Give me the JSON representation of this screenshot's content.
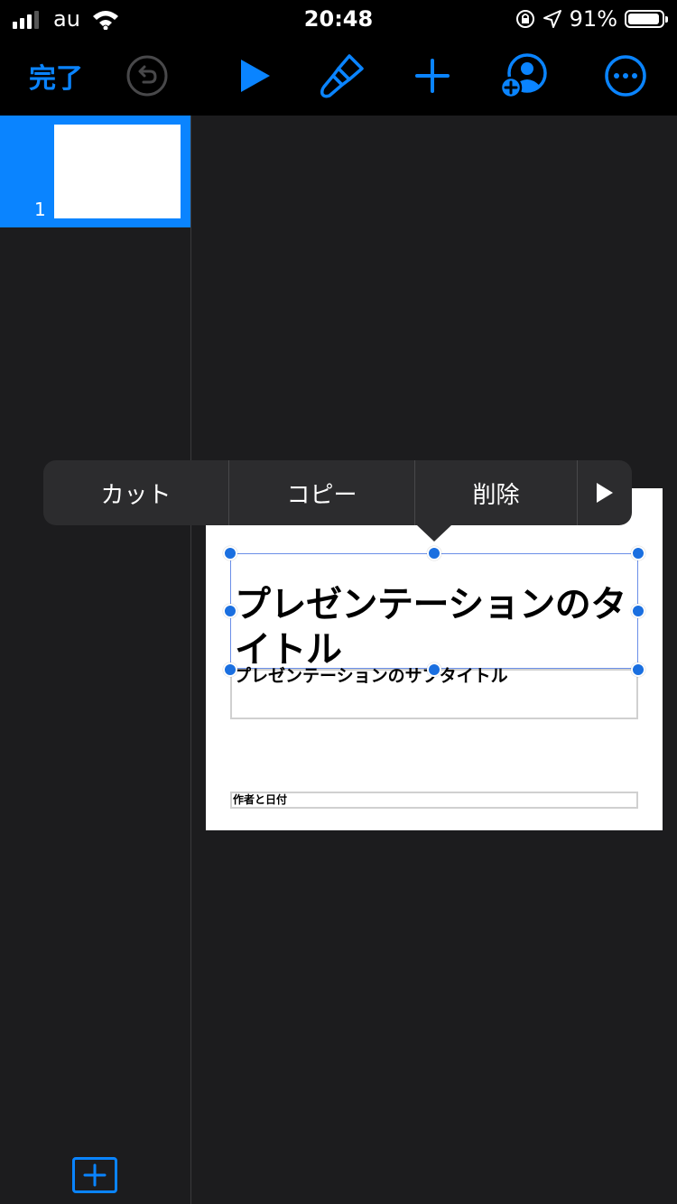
{
  "status_bar": {
    "carrier": "au",
    "time": "20:48",
    "battery_percent": "91%",
    "battery_level": 0.91,
    "icons": [
      "signal-icon",
      "wifi-icon",
      "orientation-lock-icon",
      "location-icon",
      "battery-icon"
    ]
  },
  "toolbar": {
    "done_label": "完了",
    "icons": [
      "undo-icon",
      "play-icon",
      "format-brush-icon",
      "add-icon",
      "collaborate-icon",
      "more-icon"
    ],
    "accent_color": "#0a84ff"
  },
  "sidebar": {
    "slides": [
      {
        "number": "1",
        "selected": true
      }
    ]
  },
  "slide": {
    "title": "プレゼンテーションのタイトル",
    "subtitle": "プレゼンテーションのサブタイトル",
    "author_date": "作者と日付"
  },
  "context_menu": {
    "items": [
      "カット",
      "コピー",
      "削除"
    ],
    "more_icon": "play-triangle-icon"
  }
}
